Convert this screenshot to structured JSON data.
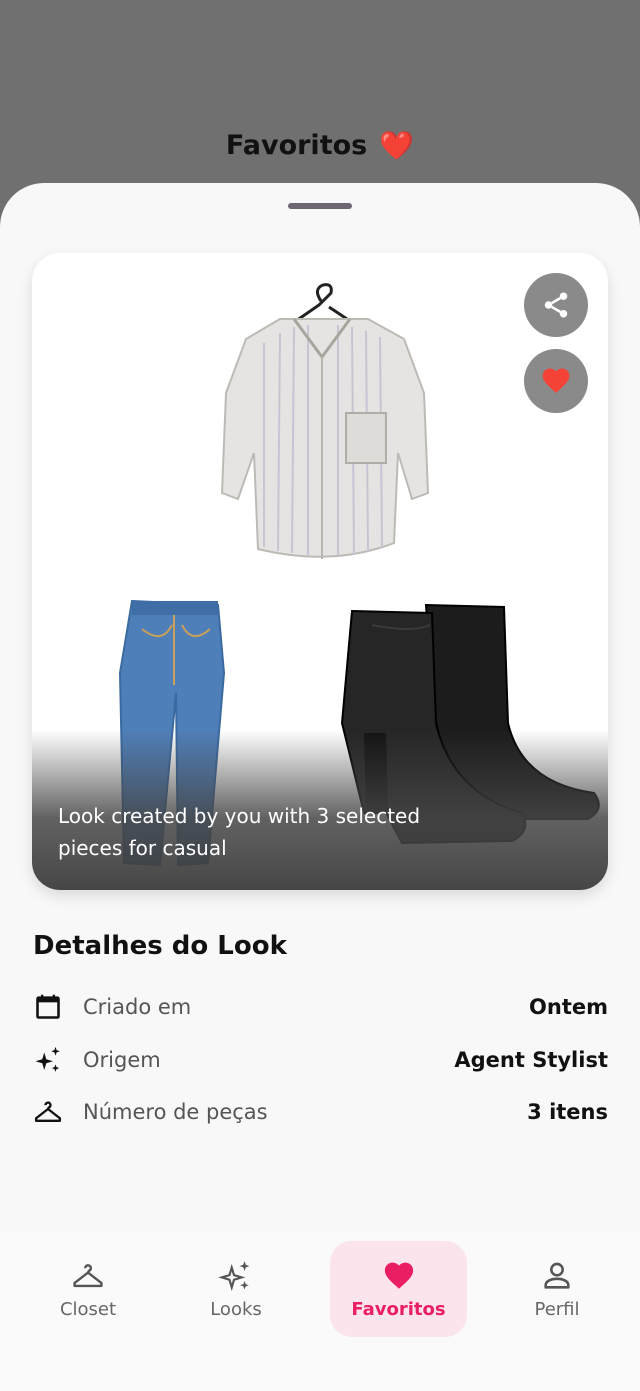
{
  "header": {
    "title": "Favoritos",
    "title_emoji": "❤️"
  },
  "card": {
    "caption": "Look created by you with 3 selected pieces for casual",
    "share_icon": "share-icon",
    "favorite_icon": "heart-icon",
    "items": [
      "striped-shirt",
      "blue-jeans",
      "black-ankle-boots"
    ]
  },
  "details": {
    "title": "Detalhes do Look",
    "rows": [
      {
        "icon": "calendar-icon",
        "label": "Criado em",
        "value": "Ontem"
      },
      {
        "icon": "sparkles-icon",
        "label": "Origem",
        "value": "Agent Stylist"
      },
      {
        "icon": "hanger-icon",
        "label": "Número de peças",
        "value": "3 itens"
      }
    ]
  },
  "nav": {
    "items": [
      {
        "icon": "hanger-icon",
        "label": "Closet"
      },
      {
        "icon": "sparkles-icon",
        "label": "Looks"
      },
      {
        "icon": "heart-icon",
        "label": "Favoritos",
        "active": true
      },
      {
        "icon": "person-icon",
        "label": "Perfil"
      }
    ]
  },
  "colors": {
    "accent": "#e91e63",
    "accent_bg": "#fbe4ec",
    "heart": "#f44336",
    "scrim": "#707070"
  }
}
